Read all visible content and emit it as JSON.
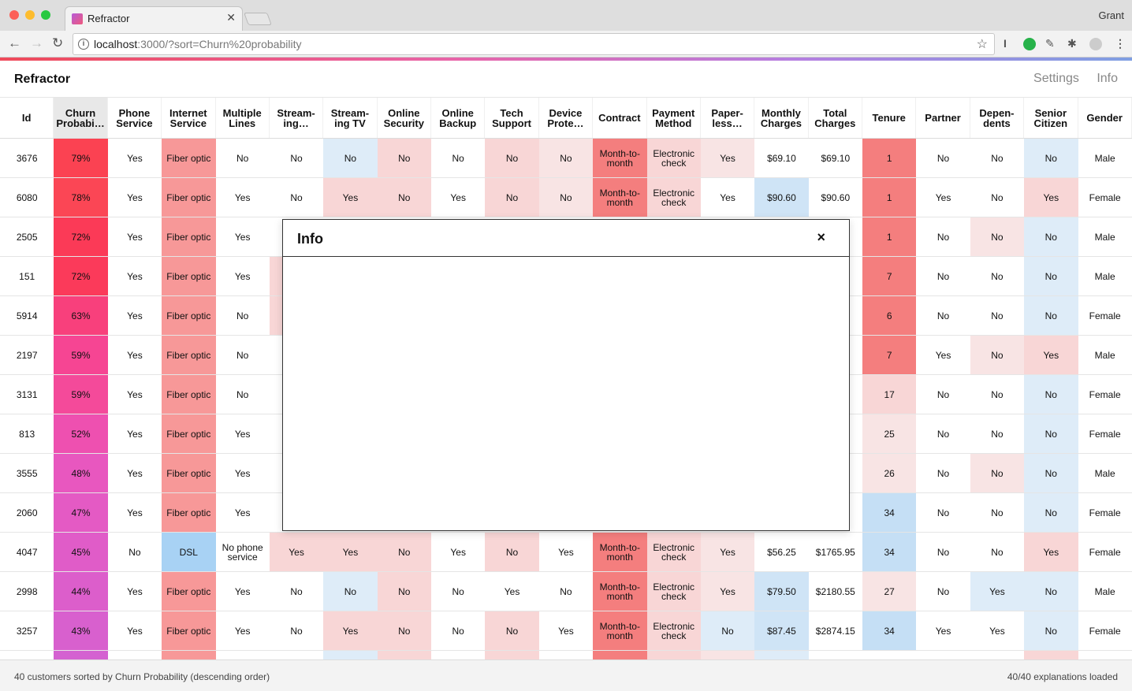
{
  "browser": {
    "tab_title": "Refractor",
    "user": "Grant",
    "url_host": "localhost",
    "url_rest": ":3000/?sort=Churn%20probability"
  },
  "app": {
    "brand": "Refractor",
    "nav": [
      "Settings",
      "Info"
    ]
  },
  "table": {
    "columns": [
      "Id",
      "Churn Probabi…",
      "Phone Service",
      "Internet Service",
      "Multiple Lines",
      "Stream-ing…",
      "Stream-ing TV",
      "Online Security",
      "Online Backup",
      "Tech Support",
      "Device Prote…",
      "Contract",
      "Payment Method",
      "Paper-less…",
      "Monthly Charges",
      "Total Charges",
      "Tenure",
      "Partner",
      "Depen-dents",
      "Senior Citizen",
      "Gender"
    ],
    "rows": [
      [
        "3676",
        "79%",
        "Yes",
        "Fiber optic",
        "No",
        "No",
        "No",
        "No",
        "No",
        "No",
        "No",
        "Month-to-month",
        "Electronic check",
        "Yes",
        "$69.10",
        "$69.10",
        "1",
        "No",
        "No",
        "No",
        "Male"
      ],
      [
        "6080",
        "78%",
        "Yes",
        "Fiber optic",
        "Yes",
        "No",
        "Yes",
        "No",
        "Yes",
        "No",
        "No",
        "Month-to-month",
        "Electronic check",
        "Yes",
        "$90.60",
        "$90.60",
        "1",
        "Yes",
        "No",
        "Yes",
        "Female"
      ],
      [
        "2505",
        "72%",
        "Yes",
        "Fiber optic",
        "Yes",
        "",
        "",
        "",
        "",
        "",
        "",
        "",
        "",
        "",
        "",
        "",
        "1",
        "No",
        "No",
        "No",
        "Male"
      ],
      [
        "151",
        "72%",
        "Yes",
        "Fiber optic",
        "Yes",
        "",
        "",
        "",
        "",
        "",
        "",
        "",
        "",
        "",
        "",
        "0",
        "7",
        "No",
        "No",
        "No",
        "Male"
      ],
      [
        "5914",
        "63%",
        "Yes",
        "Fiber optic",
        "No",
        "",
        "",
        "",
        "",
        "",
        "",
        "",
        "",
        "",
        "",
        "5",
        "6",
        "No",
        "No",
        "No",
        "Female"
      ],
      [
        "2197",
        "59%",
        "Yes",
        "Fiber optic",
        "No",
        "",
        "",
        "",
        "",
        "",
        "",
        "",
        "",
        "",
        "",
        "5",
        "7",
        "Yes",
        "No",
        "Yes",
        "Male"
      ],
      [
        "3131",
        "59%",
        "Yes",
        "Fiber optic",
        "No",
        "",
        "",
        "",
        "",
        "",
        "",
        "",
        "",
        "",
        "",
        "0",
        "17",
        "No",
        "No",
        "No",
        "Female"
      ],
      [
        "813",
        "52%",
        "Yes",
        "Fiber optic",
        "Yes",
        "",
        "",
        "",
        "",
        "",
        "",
        "",
        "",
        "",
        "",
        "5",
        "25",
        "No",
        "No",
        "No",
        "Female"
      ],
      [
        "3555",
        "48%",
        "Yes",
        "Fiber optic",
        "Yes",
        "",
        "",
        "",
        "",
        "",
        "",
        "",
        "",
        "",
        "",
        "0",
        "26",
        "No",
        "No",
        "No",
        "Male"
      ],
      [
        "2060",
        "47%",
        "Yes",
        "Fiber optic",
        "Yes",
        "",
        "",
        "",
        "",
        "",
        "",
        "",
        "",
        "",
        "",
        "0",
        "34",
        "No",
        "No",
        "No",
        "Female"
      ],
      [
        "4047",
        "45%",
        "No",
        "DSL",
        "No phone service",
        "Yes",
        "Yes",
        "No",
        "Yes",
        "No",
        "Yes",
        "Month-to-month",
        "Electronic check",
        "Yes",
        "$56.25",
        "$1765.95",
        "34",
        "No",
        "No",
        "Yes",
        "Female"
      ],
      [
        "2998",
        "44%",
        "Yes",
        "Fiber optic",
        "Yes",
        "No",
        "No",
        "No",
        "No",
        "Yes",
        "No",
        "Month-to-month",
        "Electronic check",
        "Yes",
        "$79.50",
        "$2180.55",
        "27",
        "No",
        "Yes",
        "No",
        "Male"
      ],
      [
        "3257",
        "43%",
        "Yes",
        "Fiber optic",
        "Yes",
        "No",
        "Yes",
        "No",
        "No",
        "No",
        "Yes",
        "Month-to-month",
        "Electronic check",
        "No",
        "$87.45",
        "$2874.15",
        "34",
        "Yes",
        "Yes",
        "No",
        "Female"
      ],
      [
        "",
        "",
        "",
        "",
        "",
        "",
        "",
        "",
        "",
        "",
        "",
        "",
        "",
        "",
        "",
        "",
        "",
        "",
        "",
        "",
        ""
      ]
    ],
    "backgrounds": [
      [
        "",
        "#fb4252",
        "",
        "#f79898",
        "",
        "",
        "#deecf8",
        "#f8d6d6",
        "",
        "#f8d6d6",
        "#f8e4e4",
        "#f47e7e",
        "#f8d6d6",
        "#f8e4e4",
        "",
        "",
        "#f47e7e",
        "",
        "",
        "#deecf8",
        ""
      ],
      [
        "",
        "#fb4655",
        "",
        "#f79898",
        "",
        "",
        "#f8d6d6",
        "#f8d6d6",
        "",
        "#f8d6d6",
        "#f8e4e4",
        "#f47e7e",
        "#f8d6d6",
        "",
        "#cfe4f6",
        "",
        "#f47e7e",
        "",
        "",
        "#f8d6d6",
        ""
      ],
      [
        "",
        "#fb3a57",
        "",
        "#f79898",
        "",
        "",
        "",
        "",
        "",
        "",
        "",
        "",
        "",
        "",
        "",
        "",
        "#f47e7e",
        "",
        "#f8e4e4",
        "#deecf8",
        ""
      ],
      [
        "",
        "#fb3a5a",
        "",
        "#f79898",
        "",
        "#f8d6d6",
        "",
        "",
        "",
        "",
        "",
        "",
        "",
        "",
        "",
        "",
        "#f47e7e",
        "",
        "",
        "#deecf8",
        ""
      ],
      [
        "",
        "#f8407c",
        "",
        "#f79898",
        "",
        "#f8d6d6",
        "",
        "",
        "",
        "",
        "",
        "",
        "",
        "",
        "",
        "",
        "#f47e7e",
        "",
        "",
        "#deecf8",
        ""
      ],
      [
        "",
        "#f64593",
        "",
        "#f79898",
        "",
        "",
        "",
        "",
        "",
        "",
        "",
        "",
        "",
        "",
        "",
        "",
        "#f47e7e",
        "",
        "#f8e4e4",
        "#f8d6d6",
        ""
      ],
      [
        "",
        "#f44a9a",
        "",
        "#f79898",
        "",
        "",
        "",
        "",
        "",
        "",
        "",
        "",
        "",
        "",
        "",
        "",
        "#f8d6d6",
        "",
        "",
        "#deecf8",
        ""
      ],
      [
        "",
        "#ee50b0",
        "",
        "#f79898",
        "",
        "",
        "",
        "",
        "",
        "",
        "",
        "",
        "",
        "",
        "",
        "",
        "#f8e4e4",
        "",
        "",
        "#deecf8",
        ""
      ],
      [
        "",
        "#e857bf",
        "",
        "#f79898",
        "",
        "",
        "",
        "",
        "",
        "",
        "",
        "",
        "",
        "",
        "",
        "",
        "#f8e4e4",
        "",
        "#f8e4e4",
        "#deecf8",
        ""
      ],
      [
        "",
        "#e45ac4",
        "",
        "#f79898",
        "",
        "",
        "",
        "",
        "",
        "",
        "",
        "",
        "",
        "",
        "",
        "",
        "#c5dff5",
        "",
        "",
        "#deecf8",
        ""
      ],
      [
        "",
        "#e05cc8",
        "",
        "#a8d2f4",
        "",
        "#f8d6d6",
        "#f8d6d6",
        "#f8d6d6",
        "",
        "#f8d6d6",
        "",
        "#f47e7e",
        "#f8d6d6",
        "#f8e4e4",
        "",
        "",
        "#c5dff5",
        "",
        "",
        "#f8d6d6",
        ""
      ],
      [
        "",
        "#dc5ecb",
        "",
        "#f79898",
        "",
        "",
        "#deecf8",
        "#f8d6d6",
        "",
        "",
        "",
        "#f47e7e",
        "#f8d6d6",
        "#f8e4e4",
        "#cfe4f6",
        "",
        "#f8e4e4",
        "",
        "#deecf8",
        "#deecf8",
        ""
      ],
      [
        "",
        "#d860ce",
        "",
        "#f79898",
        "",
        "",
        "#f8d6d6",
        "#f8d6d6",
        "",
        "#f8d6d6",
        "",
        "#f47e7e",
        "#f8d6d6",
        "#deecf8",
        "#cfe4f6",
        "",
        "#c5dff5",
        "",
        "",
        "#deecf8",
        ""
      ],
      [
        "",
        "#d462d1",
        "",
        "#f79898",
        "",
        "",
        "#deecf8",
        "#f8d6d6",
        "",
        "#f8d6d6",
        "",
        "#f47e7e",
        "#f8d6d6",
        "#f8e4e4",
        "#deecf8",
        "",
        "",
        "",
        "",
        "#f8d6d6",
        ""
      ]
    ]
  },
  "modal": {
    "title": "Info",
    "close": "×"
  },
  "footer": {
    "left": "40 customers sorted by Churn Probability (descending order)",
    "right": "40/40 explanations loaded"
  }
}
